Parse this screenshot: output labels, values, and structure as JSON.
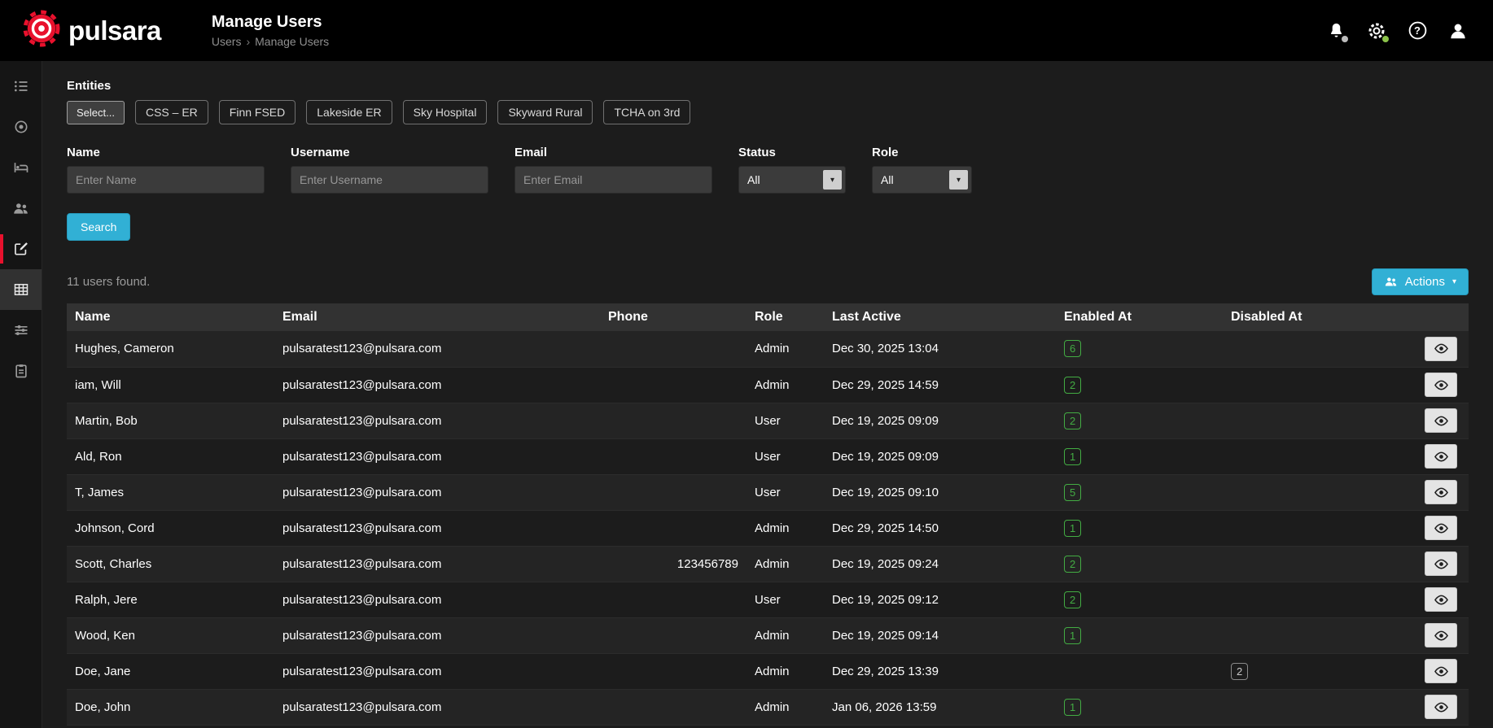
{
  "header": {
    "logo_text": "pulsara",
    "page_title": "Manage Users",
    "breadcrumb": {
      "parent": "Users",
      "separator": "›",
      "current": "Manage Users"
    }
  },
  "icons": {
    "help_glyph": "?",
    "caret_glyph": "▾"
  },
  "filters": {
    "entities_label": "Entities",
    "select_button_label": "Select...",
    "entity_chips": [
      "CSS – ER",
      "Finn FSED",
      "Lakeside ER",
      "Sky Hospital",
      "Skyward Rural",
      "TCHA on 3rd"
    ],
    "fields": [
      {
        "label": "Name",
        "placeholder": "Enter Name"
      },
      {
        "label": "Username",
        "placeholder": "Enter Username"
      },
      {
        "label": "Email",
        "placeholder": "Enter Email"
      }
    ],
    "selects": [
      {
        "label": "Status",
        "value": "All"
      },
      {
        "label": "Role",
        "value": "All"
      }
    ],
    "search_button_label": "Search"
  },
  "results": {
    "count_text": "11 users found.",
    "actions_button_label": "Actions"
  },
  "table": {
    "columns": [
      "Name",
      "Email",
      "Phone",
      "Role",
      "Last Active",
      "Enabled At",
      "Disabled At"
    ],
    "rows": [
      {
        "name": "Hughes, Cameron",
        "email": "pulsaratest123@pulsara.com",
        "phone": "",
        "role": "Admin",
        "last_active": "Dec 30, 2025 13:04",
        "enabled_at": "6",
        "disabled_at": ""
      },
      {
        "name": "iam, Will",
        "email": "pulsaratest123@pulsara.com",
        "phone": "",
        "role": "Admin",
        "last_active": "Dec 29, 2025 14:59",
        "enabled_at": "2",
        "disabled_at": ""
      },
      {
        "name": "Martin, Bob",
        "email": "pulsaratest123@pulsara.com",
        "phone": "",
        "role": "User",
        "last_active": "Dec 19, 2025 09:09",
        "enabled_at": "2",
        "disabled_at": ""
      },
      {
        "name": "Ald, Ron",
        "email": "pulsaratest123@pulsara.com",
        "phone": "",
        "role": "User",
        "last_active": "Dec 19, 2025 09:09",
        "enabled_at": "1",
        "disabled_at": ""
      },
      {
        "name": "T, James",
        "email": "pulsaratest123@pulsara.com",
        "phone": "",
        "role": "User",
        "last_active": "Dec 19, 2025 09:10",
        "enabled_at": "5",
        "disabled_at": ""
      },
      {
        "name": "Johnson, Cord",
        "email": "pulsaratest123@pulsara.com",
        "phone": "",
        "role": "Admin",
        "last_active": "Dec 29, 2025 14:50",
        "enabled_at": "1",
        "disabled_at": ""
      },
      {
        "name": "Scott, Charles",
        "email": "pulsaratest123@pulsara.com",
        "phone": "123456789",
        "role": "Admin",
        "last_active": "Dec 19, 2025 09:24",
        "enabled_at": "2",
        "disabled_at": ""
      },
      {
        "name": "Ralph, Jere",
        "email": "pulsaratest123@pulsara.com",
        "phone": "",
        "role": "User",
        "last_active": "Dec 19, 2025 09:12",
        "enabled_at": "2",
        "disabled_at": ""
      },
      {
        "name": "Wood, Ken",
        "email": "pulsaratest123@pulsara.com",
        "phone": "",
        "role": "Admin",
        "last_active": "Dec 19, 2025 09:14",
        "enabled_at": "1",
        "disabled_at": ""
      },
      {
        "name": "Doe, Jane",
        "email": "pulsaratest123@pulsara.com",
        "phone": "",
        "role": "Admin",
        "last_active": "Dec 29, 2025 13:39",
        "enabled_at": "",
        "disabled_at": "2"
      },
      {
        "name": "Doe, John",
        "email": "pulsaratest123@pulsara.com",
        "phone": "",
        "role": "Admin",
        "last_active": "Jan 06, 2026 13:59",
        "enabled_at": "1",
        "disabled_at": ""
      }
    ]
  },
  "colors": {
    "brand_red": "#e8112d",
    "accent_blue": "#31b0d5",
    "badge_green": "#43ac43",
    "presence_green": "#8bc34a"
  }
}
